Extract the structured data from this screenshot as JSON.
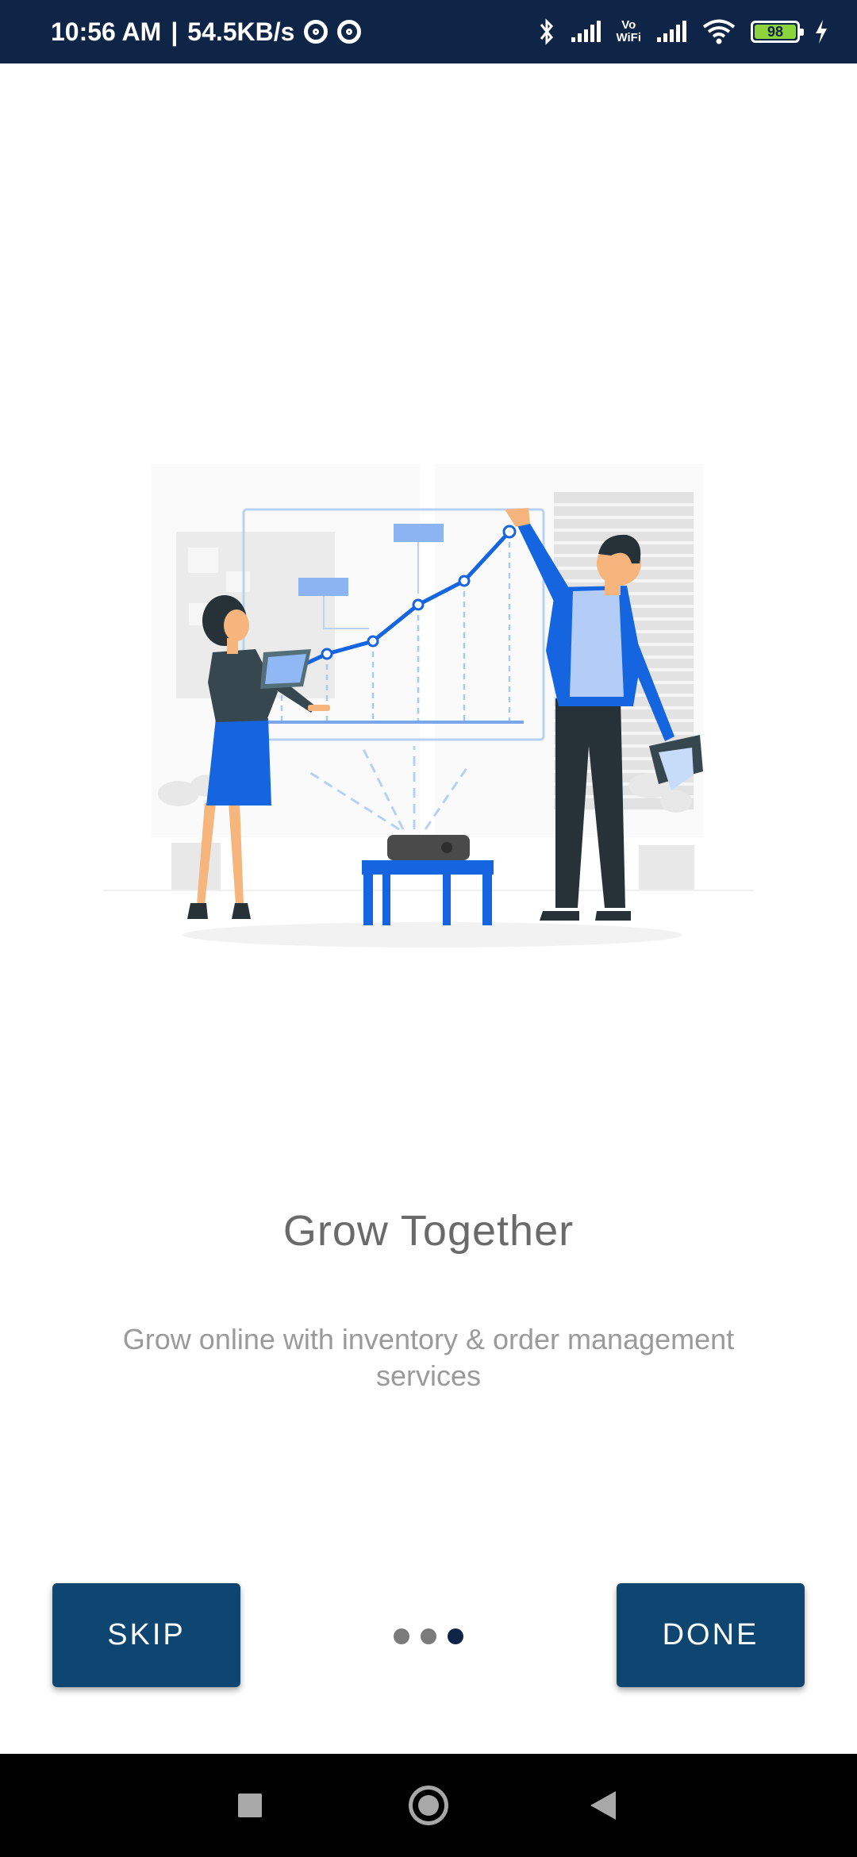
{
  "status_bar": {
    "time": "10:56 AM",
    "separator": "|",
    "speed": "54.5KB/s",
    "vowifi_top": "Vo",
    "vowifi_bottom": "WiFi",
    "battery_level": "98",
    "icons": [
      "at-sign-icon",
      "at-sign-icon",
      "bluetooth-icon",
      "signal-icon",
      "vowifi-icon",
      "signal-icon",
      "wifi-icon",
      "battery-icon",
      "charging-icon"
    ]
  },
  "illustration": {
    "name": "business-growth-illustration",
    "colors": {
      "accent": "#1565e0",
      "light_blue": "#8fb8f5",
      "dark": "#263238",
      "skin": "#f5b57c",
      "grey": "#ebebeb"
    }
  },
  "onboarding": {
    "title": "Grow Together",
    "description": "Grow online with inventory & order management services",
    "page_index": 3,
    "page_count": 3
  },
  "controls": {
    "skip_label": "SKIP",
    "done_label": "DONE",
    "button_color": "#0e4671"
  },
  "nav_bar": {
    "icons": [
      "recent-apps-icon",
      "home-icon",
      "back-icon"
    ]
  }
}
